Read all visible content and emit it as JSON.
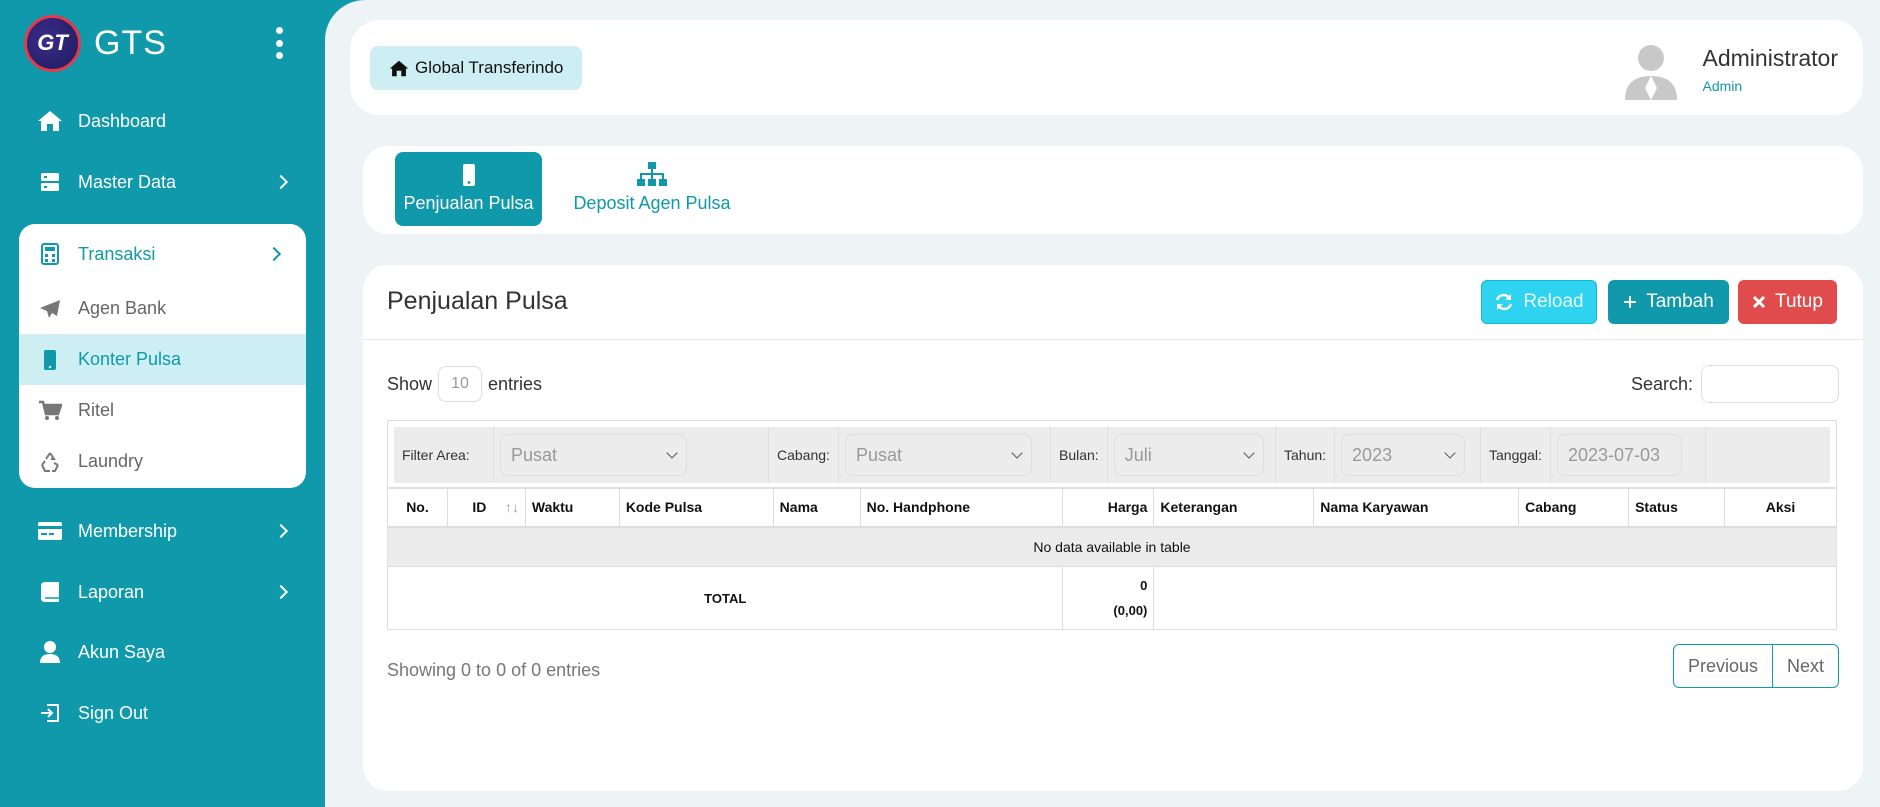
{
  "brand": {
    "name": "GTS",
    "logo_text": "GT"
  },
  "sidebar": {
    "items": [
      {
        "label": "Dashboard",
        "icon": "home-icon"
      },
      {
        "label": "Master Data",
        "icon": "server-icon"
      },
      {
        "label": "Membership",
        "icon": "credit-card-icon"
      },
      {
        "label": "Laporan",
        "icon": "book-icon"
      },
      {
        "label": "Akun Saya",
        "icon": "user-icon"
      },
      {
        "label": "Sign Out",
        "icon": "sign-out-icon"
      }
    ],
    "transaksi": {
      "label": "Transaksi",
      "icon": "calculator-icon",
      "children": [
        {
          "label": "Agen Bank",
          "icon": "paper-plane-icon"
        },
        {
          "label": "Konter Pulsa",
          "icon": "mobile-icon"
        },
        {
          "label": "Ritel",
          "icon": "cart-icon"
        },
        {
          "label": "Laundry",
          "icon": "recycle-icon"
        }
      ]
    }
  },
  "header": {
    "company": "Global Transferindo",
    "user_name": "Administrator",
    "user_role": "Admin"
  },
  "tabs": [
    {
      "label": "Penjualan Pulsa",
      "icon": "mobile-icon"
    },
    {
      "label": "Deposit Agen Pulsa",
      "icon": "sitemap-icon"
    }
  ],
  "card": {
    "title": "Penjualan Pulsa",
    "buttons": {
      "reload": "Reload",
      "tambah": "Tambah",
      "tutup": "Tutup"
    },
    "show_label": "Show",
    "entries_label": "entries",
    "length_value": "10",
    "search_label": "Search:",
    "filters": {
      "area_label": "Filter Area:",
      "area_value": "Pusat",
      "cabang_label": "Cabang:",
      "cabang_value": "Pusat",
      "bulan_label": "Bulan:",
      "bulan_value": "Juli",
      "tahun_label": "Tahun:",
      "tahun_value": "2023",
      "tanggal_label": "Tanggal:",
      "tanggal_value": "2023-07-03"
    },
    "columns": [
      "No.",
      "ID",
      "Waktu",
      "Kode Pulsa",
      "Nama",
      "No. Handphone",
      "Harga",
      "Keterangan",
      "Nama Karyawan",
      "Cabang",
      "Status",
      "Aksi"
    ],
    "empty_message": "No data available in table",
    "total_label": "TOTAL",
    "total_value": "0",
    "total_sub": "(0,00)",
    "info": "Showing 0 to 0 of 0 entries",
    "pager": {
      "previous": "Previous",
      "next": "Next"
    }
  },
  "colors": {
    "accent": "#1099aa",
    "reload": "#2dd3ef",
    "danger": "#e04b4b"
  }
}
